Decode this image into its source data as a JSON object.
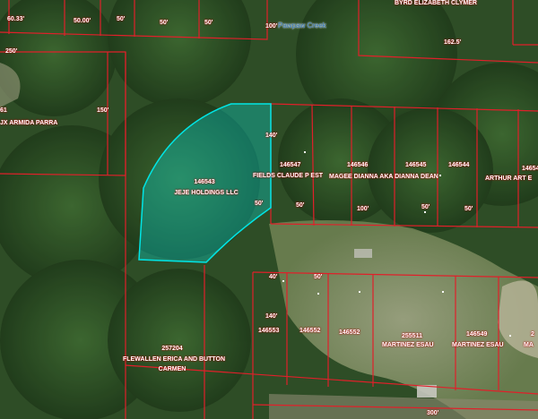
{
  "creek": {
    "name": "Pawpaw Creek"
  },
  "subject": {
    "id": "146543",
    "owner": "JEJE HOLDINGS LLC",
    "dim_top": "140'",
    "dim_right": "50'",
    "highlight": "#00e5e5"
  },
  "top_labels": {
    "owner": "BYRD ELIZABETH CLYMER",
    "d1": "60.33'",
    "d2": "50.00'",
    "d3": "50'",
    "d4": "50'",
    "d5": "50'",
    "d6": "100'",
    "d7": "162.5'",
    "d8": "250'"
  },
  "left_labels": {
    "l1": "61",
    "owner": "JX ARMIDA PARRA",
    "d1": "150'"
  },
  "right_parcels": [
    {
      "id": "146547",
      "owner": "FIELDS CLAUDE P EST",
      "dim": "50'"
    },
    {
      "id": "146546",
      "owner": "MAGEE DIANNA AKA DIANNA DEAN",
      "dim": "100'"
    },
    {
      "id": "146545",
      "dim": "50'"
    },
    {
      "id": "146544",
      "dim": "50'"
    },
    {
      "id": "14654",
      "owner": "ARTHUR ART E"
    }
  ],
  "bottom_parcels": [
    {
      "id": "146553",
      "dim_a": "40'",
      "dim_b": "140'"
    },
    {
      "id": "146552",
      "dim": "50'"
    },
    {
      "id": "146552b",
      "label": "146552"
    },
    {
      "id": "255511",
      "owner": "MARTINEZ ESAU"
    },
    {
      "id": "146549",
      "owner": "MARTINEZ ESAU"
    },
    {
      "id": "2",
      "owner": "MA"
    }
  ],
  "bottom_left": {
    "id": "257204",
    "owner1": "FLEWALLEN ERICA AND BUTTON",
    "owner2": "CARMEN"
  },
  "bottom_dim": "300'",
  "colors": {
    "boundary": "#e0202a",
    "forest": "#2f5a2a",
    "clearing": "#9aa07a"
  }
}
